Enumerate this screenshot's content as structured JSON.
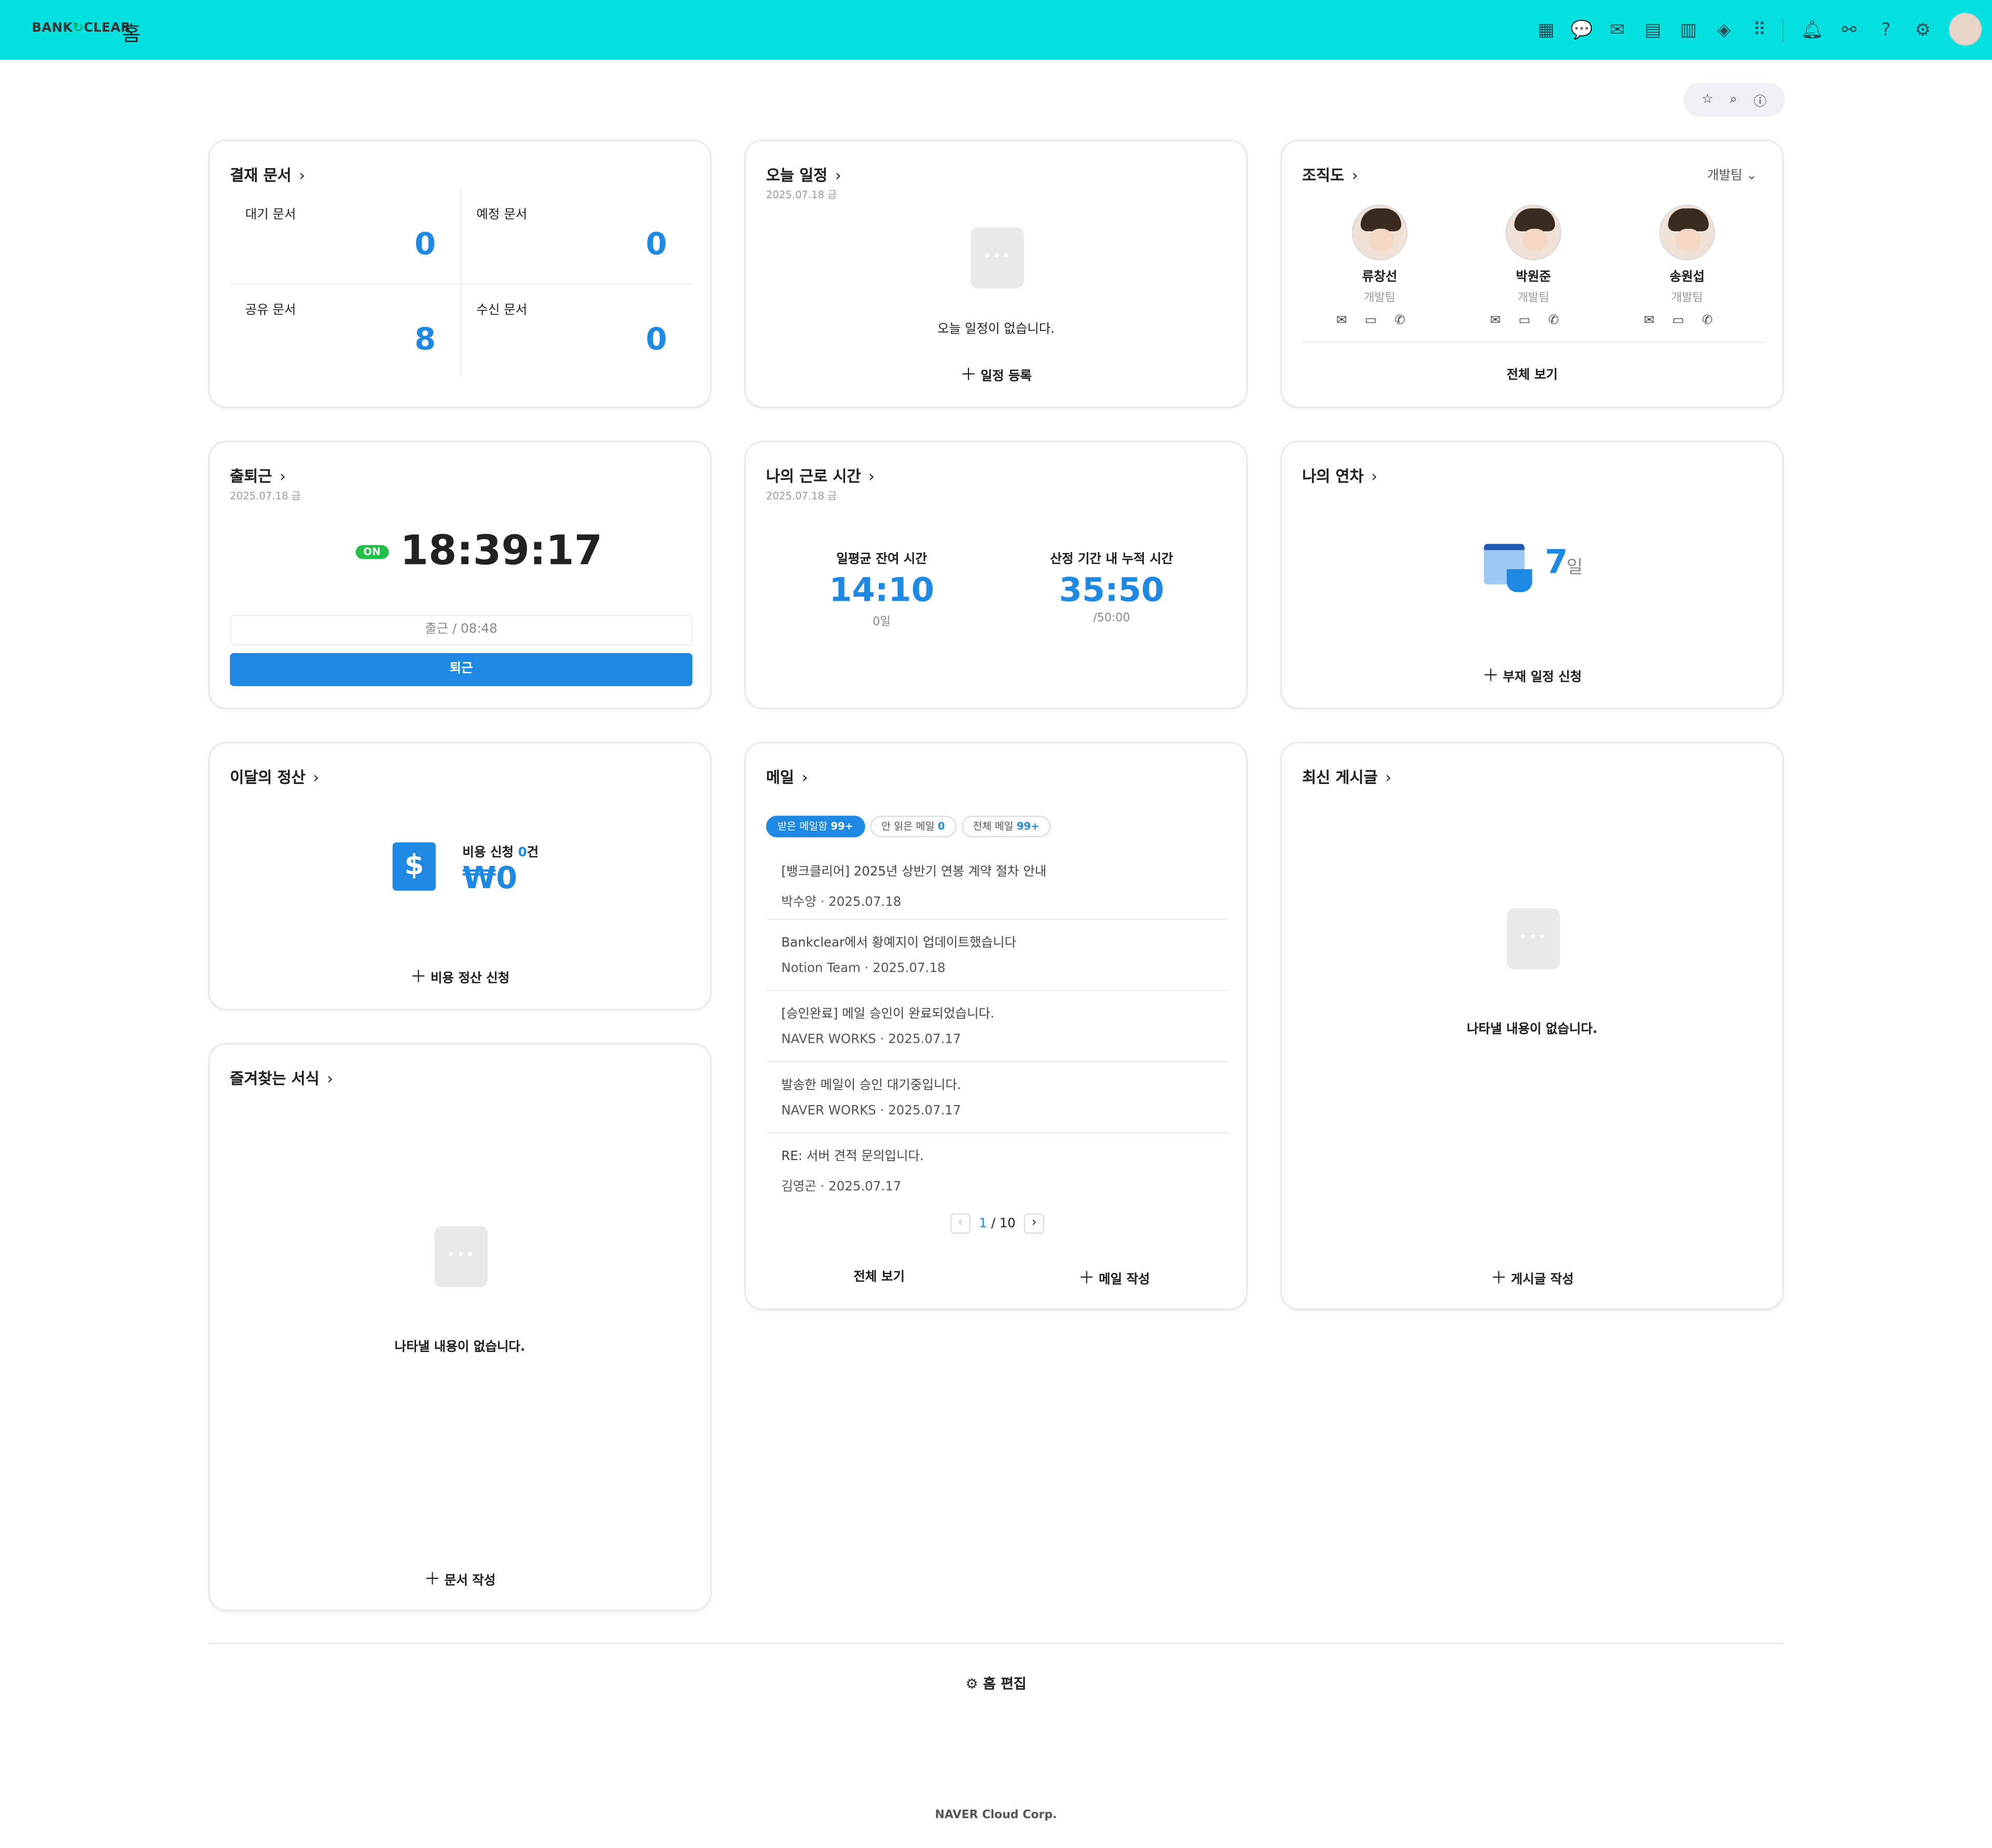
{
  "header": {
    "logo_left": "BANK",
    "logo_right": "CLEAR",
    "page_title": "홈",
    "apps": [
      "dashboard-icon",
      "chat-icon",
      "mail-icon",
      "calendar-icon",
      "notes-icon",
      "drive-icon",
      "apps-grid-icon"
    ],
    "utilities": [
      "bell-icon",
      "org-icon",
      "help-icon",
      "settings-icon"
    ]
  },
  "toolbar": {
    "icons": [
      "star-icon",
      "search-icon",
      "info-icon"
    ]
  },
  "approval": {
    "title": "결재 문서",
    "cells": [
      {
        "label": "대기 문서",
        "value": "0"
      },
      {
        "label": "예정 문서",
        "value": "0"
      },
      {
        "label": "공유 문서",
        "value": "8"
      },
      {
        "label": "수신 문서",
        "value": "0"
      }
    ]
  },
  "schedule": {
    "title": "오늘 일정",
    "date": "2025.07.18 금",
    "empty": "오늘 일정이 없습니다.",
    "action": "일정 등록"
  },
  "org": {
    "title": "조직도",
    "team_select": "개발팀",
    "people": [
      {
        "name": "류창선",
        "team": "개발팀"
      },
      {
        "name": "박원준",
        "team": "개발팀"
      },
      {
        "name": "송원섭",
        "team": "개발팀"
      }
    ],
    "view_all": "전체 보기"
  },
  "commute": {
    "title": "출퇴근",
    "date": "2025.07.18 금",
    "status": "ON",
    "time": "18:39:17",
    "checkin": "출근 / 08:48",
    "button": "퇴근"
  },
  "worktime": {
    "title": "나의 근로 시간",
    "date": "2025.07.18 금",
    "left_label": "일평균 잔여 시간",
    "left_value": "14:10",
    "left_sub": "0일",
    "right_label": "산정 기간 내 누적 시간",
    "right_value": "35:50",
    "right_sub": "/50:00"
  },
  "leave": {
    "title": "나의 연차",
    "value": "7",
    "unit": "일",
    "action": "부재 일정 신청"
  },
  "settlement": {
    "title": "이달의 정산",
    "label_pre": "비용 신청 ",
    "count": "0",
    "label_post": "건",
    "amount": "₩0",
    "action": "비용 정산 신청"
  },
  "mail": {
    "title": "메일",
    "tabs": [
      {
        "label": "받은 메일함",
        "count": "99+"
      },
      {
        "label": "안 읽은 메일",
        "count": "0"
      },
      {
        "label": "전체 메일",
        "count": "99+"
      }
    ],
    "items": [
      {
        "subject": "[뱅크클리어] 2025년 상반기 연봉 계약 절차 안내",
        "from": "박수양",
        "date": "2025.07.18"
      },
      {
        "subject": "Bankclear에서 황예지이 업데이트했습니다",
        "from": "Notion Team",
        "date": "2025.07.18"
      },
      {
        "subject": "[승인완료] 메일 승인이 완료되었습니다.",
        "from": "NAVER WORKS",
        "date": "2025.07.17"
      },
      {
        "subject": "발송한 메일이 승인 대기중입니다.",
        "from": "NAVER WORKS",
        "date": "2025.07.17"
      },
      {
        "subject": "RE: 서버 견적 문의입니다.",
        "from": "김영곤",
        "date": "2025.07.17"
      }
    ],
    "page_current": "1",
    "page_total": "/ 10",
    "view_all": "전체 보기",
    "compose": "메일 작성"
  },
  "board": {
    "title": "최신 게시글",
    "empty": "나타낼 내용이 없습니다.",
    "action": "게시글 작성"
  },
  "forms": {
    "title": "즐겨찾는 서식",
    "empty": "나타낼 내용이 없습니다.",
    "action": "문서 작성"
  },
  "footer": {
    "edit_home": "홈 편집",
    "copyright": "NAVER Cloud Corp."
  }
}
